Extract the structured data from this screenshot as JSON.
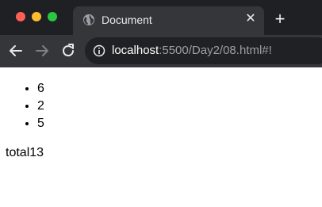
{
  "colors": {
    "close_dot": "#ff5f57",
    "minimize_dot": "#febc2e",
    "zoom_dot": "#28c840",
    "tab_strip": "#1f2023",
    "active_tab": "#35363a",
    "omnibox": "#202124"
  },
  "browser": {
    "tab_title": "Document",
    "tab_close_icon": "close-icon",
    "new_tab_icon": "plus-icon",
    "url_host": "localhost",
    "url_rest": ":5500/Day2/08.html#!"
  },
  "page": {
    "items": [
      "6",
      "2",
      "5"
    ],
    "total_text": "total13"
  }
}
